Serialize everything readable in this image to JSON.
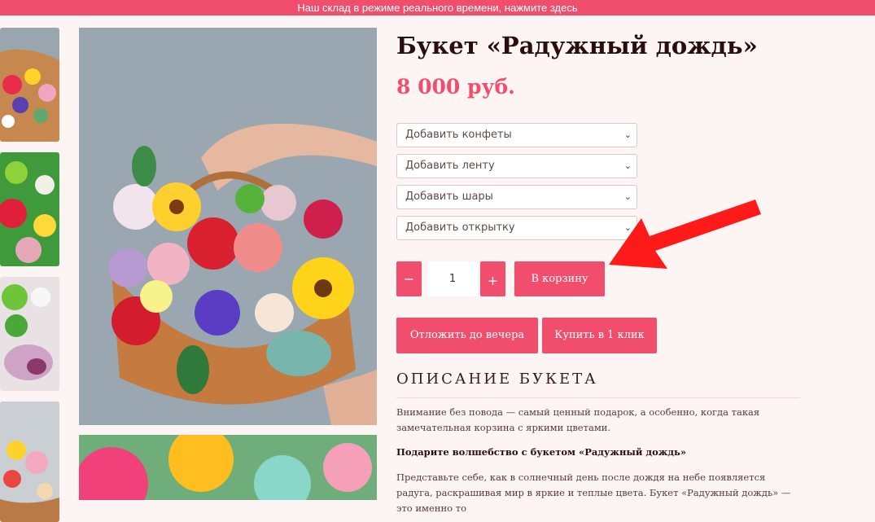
{
  "topbar": {
    "text": "Наш склад в режиме реального времени, нажмите здесь"
  },
  "product": {
    "title": "Букет «Радужный дождь»",
    "price": "8 000 руб."
  },
  "options": [
    {
      "label": "Добавить конфеты"
    },
    {
      "label": "Добавить ленту"
    },
    {
      "label": "Добавить шары"
    },
    {
      "label": "Добавить открытку"
    }
  ],
  "cart": {
    "minus": "−",
    "quantity": "1",
    "plus": "+",
    "add_to_cart": "В корзину"
  },
  "actions": {
    "reserve": "Отложить до вечера",
    "buy_one_click": "Купить в 1 клик"
  },
  "description": {
    "heading": "ОПИСАНИЕ БУКЕТА",
    "p1": "Внимание без повода — самый ценный подарок, а особенно, когда такая замечательная корзина с яркими цветами.",
    "p2": "Подарите волшебство с букетом «Радужный дождь»",
    "p3": "Представьте себе, как в солнечный день после дождя на небе появляется радуга, раскрашивая мир в яркие и теплые цвета. Букет «Радужный дождь» — это именно то"
  },
  "colors": {
    "accent": "#f04e6c",
    "background": "#fdf4f4",
    "annotation_arrow": "#ff1a1a"
  }
}
